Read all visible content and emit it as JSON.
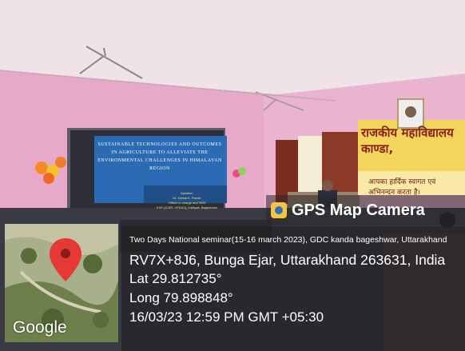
{
  "overlay": {
    "app_name": "GPS Map Camera",
    "seminar_line": "Two Days National seminar(15-16 march 2023), GDC kanda bageshwar, Uttarakhand",
    "address": "RV7X+8J6, Bunga Ejar, Uttarakhand 263631, India",
    "latitude": "Lat 29.812735°",
    "longitude": "Long 79.898848°",
    "datetime": "16/03/23 12:59 PM GMT +05:30",
    "map_brand": "Google",
    "app_icon": "camera-icon",
    "pin_icon": "map-pin-icon"
  },
  "slide": {
    "title": "SUSTAINABLE TECHNOLOGIES AND OUTCOMES IN AGRICULTURE TO ALLEVIATE THE ENVIRONMENTAL CHALLENGES IN HIMALAYAN REGION",
    "speaker_label": "Speaker:",
    "speaker_name": "Dr. Kamal K. Pande",
    "speaker_role": "Officer in-charge and SMS",
    "speaker_org": "KVK (ICAR- VPKAS), Kafligair, Bageshwar"
  },
  "banner": {
    "heading": "राजकीय महाविद्यालय काण्डा,",
    "welcome": "आपका हार्दिक स्वागत एवं अभिनन्दन करता है।"
  },
  "colors": {
    "wall": "#e7a7c6",
    "ceiling": "#f3e7ec",
    "overlay_bg": "#2a2a2a",
    "pin": "#e53935"
  }
}
